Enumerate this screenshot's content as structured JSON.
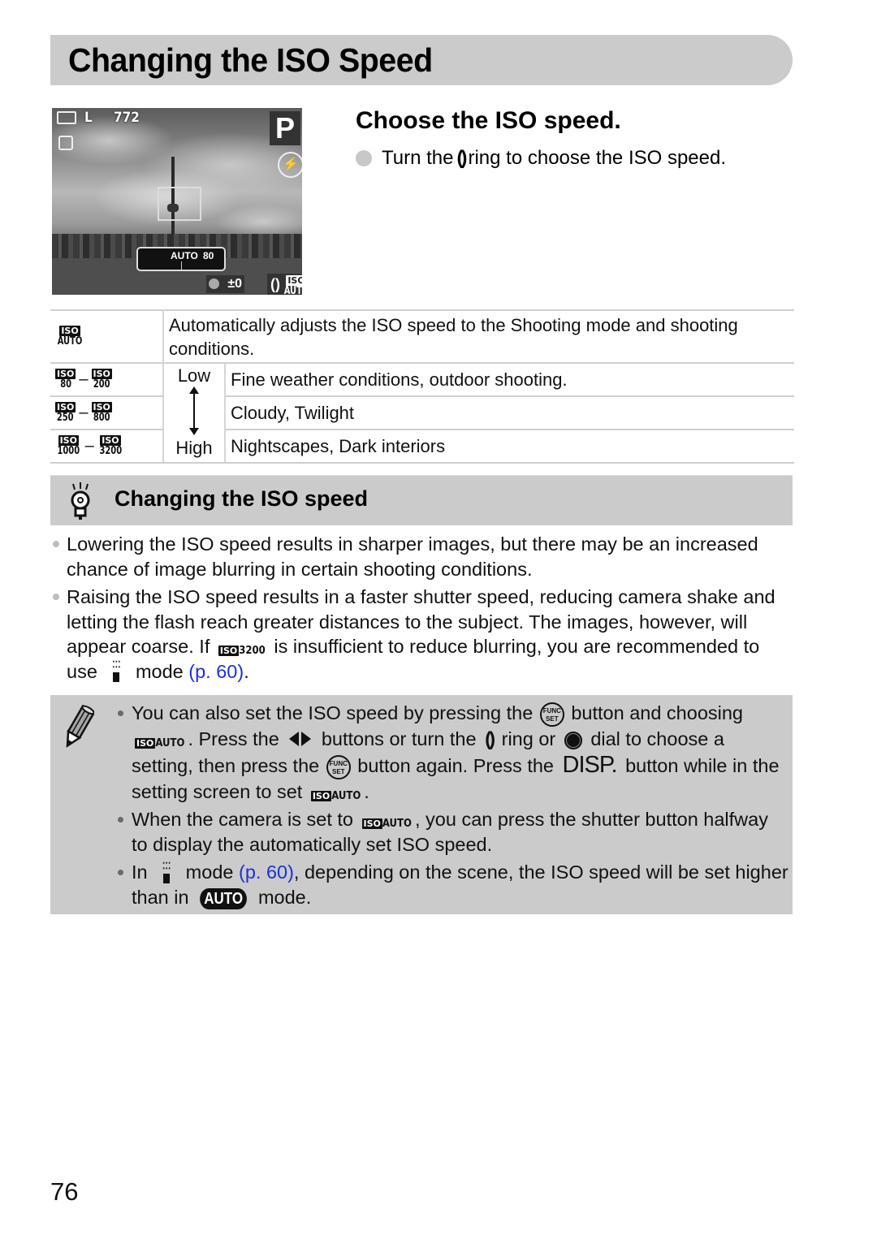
{
  "header": {
    "title": "Changing the ISO Speed"
  },
  "lcd_preview": {
    "quality": "L",
    "shots_remaining": "772",
    "mode": "P",
    "iso_scale_left": "AUTO",
    "iso_scale_right": "80",
    "exposure_comp": "±0",
    "iso_setting_top": "ISO",
    "iso_setting_bottom": "AUTO"
  },
  "step": {
    "title": "Choose the ISO speed.",
    "instruction_before": "Turn the",
    "ring_glyph": "()",
    "instruction_after": "ring to choose the ISO speed."
  },
  "iso_table": {
    "auto_row": {
      "badge_top": "ISO",
      "badge_bottom": "AUTO",
      "description": "Automatically adjusts the ISO speed to the Shooting mode and shooting conditions."
    },
    "low_label": "Low",
    "high_label": "High",
    "dash": "–",
    "rows": [
      {
        "from": "80",
        "to": "200",
        "description": "Fine weather conditions, outdoor shooting."
      },
      {
        "from": "250",
        "to": "800",
        "description": "Cloudy, Twilight"
      },
      {
        "from": "1000",
        "to": "3200",
        "description": "Nightscapes, Dark interiors"
      }
    ]
  },
  "hint": {
    "title": "Changing the ISO speed",
    "bullets": [
      {
        "text": "Lowering the ISO speed results in sharper images, but there may be an increased chance of image blurring in certain shooting conditions."
      },
      {
        "text_a": "Raising the ISO speed results in a faster shutter speed, reducing camera shake and letting the flash reach greater distances to the subject. The images, however, will appear coarse. If",
        "badge_value": "3200",
        "text_b": "is insufficient to reduce blurring, you are recommended to use",
        "text_c": "mode",
        "link": "(p. 60)",
        "text_d": "."
      }
    ]
  },
  "note": {
    "items": [
      {
        "a": "You can also set the ISO speed by pressing the",
        "func_label": "FUNC SET",
        "b": "button and choosing",
        "c": ". Press the",
        "d": "buttons or turn the",
        "ring_glyph": "()",
        "e": "ring or",
        "f": "dial to choose a setting, then press the",
        "g": "button again. Press the",
        "disp_label": "DISP.",
        "h": "button while in the setting screen to set",
        "i": "."
      },
      {
        "a": "When the camera is set to",
        "b": ", you can press the shutter button halfway to display the automatically set ISO speed."
      },
      {
        "a": "In",
        "b": "mode",
        "link": "(p. 60)",
        "c": ", depending on the scene, the ISO speed will be set higher than in",
        "auto_label": "AUTO",
        "d": "mode."
      }
    ]
  },
  "iso_badge_text": {
    "iso": "ISO",
    "auto": "AUTO"
  },
  "page_number": "76",
  "colors": {
    "band_gray": "#cbcbcb",
    "link_blue": "#1a32d8"
  }
}
